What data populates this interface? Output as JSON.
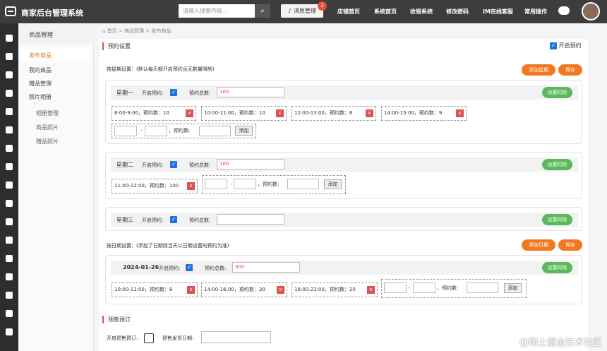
{
  "top": {
    "brand": "商家后台管理系统",
    "search_placeholder": "请输入搜索内容...",
    "message": "消息管理",
    "badge": "3",
    "nav": [
      "店铺首页",
      "系统首页",
      "收银系统",
      "修改密码",
      "IM在线客服",
      "常用操作"
    ]
  },
  "sidebar": {
    "title": "商品管理",
    "items": [
      "发布商品",
      "我的商品",
      "赠品管理",
      "照片相册"
    ],
    "subitems": [
      "相册管理",
      "商品照片",
      "赠品照片"
    ]
  },
  "breadcrumb": [
    "首页",
    "商品管理",
    "发布商品"
  ],
  "booking": {
    "title": "预约设置",
    "enable": "开启预约",
    "week_desc": "按星期设置：(默认每天都开启预约且无数量限制)",
    "date_desc": "按日期设置：(添加了日期则当天以日期设置的预约为准)",
    "add_week": "添加星期",
    "add_date": "添加日期",
    "save": "保存",
    "set_time": "设置时段",
    "open_label": "开启预约:",
    "total_label": "预约总数:",
    "count_label": "，预约数:",
    "add_btn": "添加",
    "days": [
      {
        "day": "星期一",
        "total": "100",
        "slots": [
          "8:00-9:00，预约数：10",
          "10:00-11:00，预约数：10",
          "12:00-13:00，预约数：8",
          "14:00-15:00，预约数：9"
        ]
      },
      {
        "day": "星期二",
        "total": "100",
        "slots": [
          "11:00-22:00，预约数：100"
        ]
      },
      {
        "day": "星期三",
        "total": "",
        "slots": []
      }
    ],
    "date": {
      "day": "2024-01-26",
      "total": "300",
      "slots": [
        "10:00-11:00，预约数：8",
        "14:00-16:00，预约数：30",
        "18:00-23:00，预约数：20"
      ]
    }
  },
  "presale": {
    "title": "预售预订",
    "enable": "开启预售预订:",
    "delivery": "预售发货日期:"
  },
  "watermark": "@稀土掘金技术社区",
  "del_mark": "x"
}
